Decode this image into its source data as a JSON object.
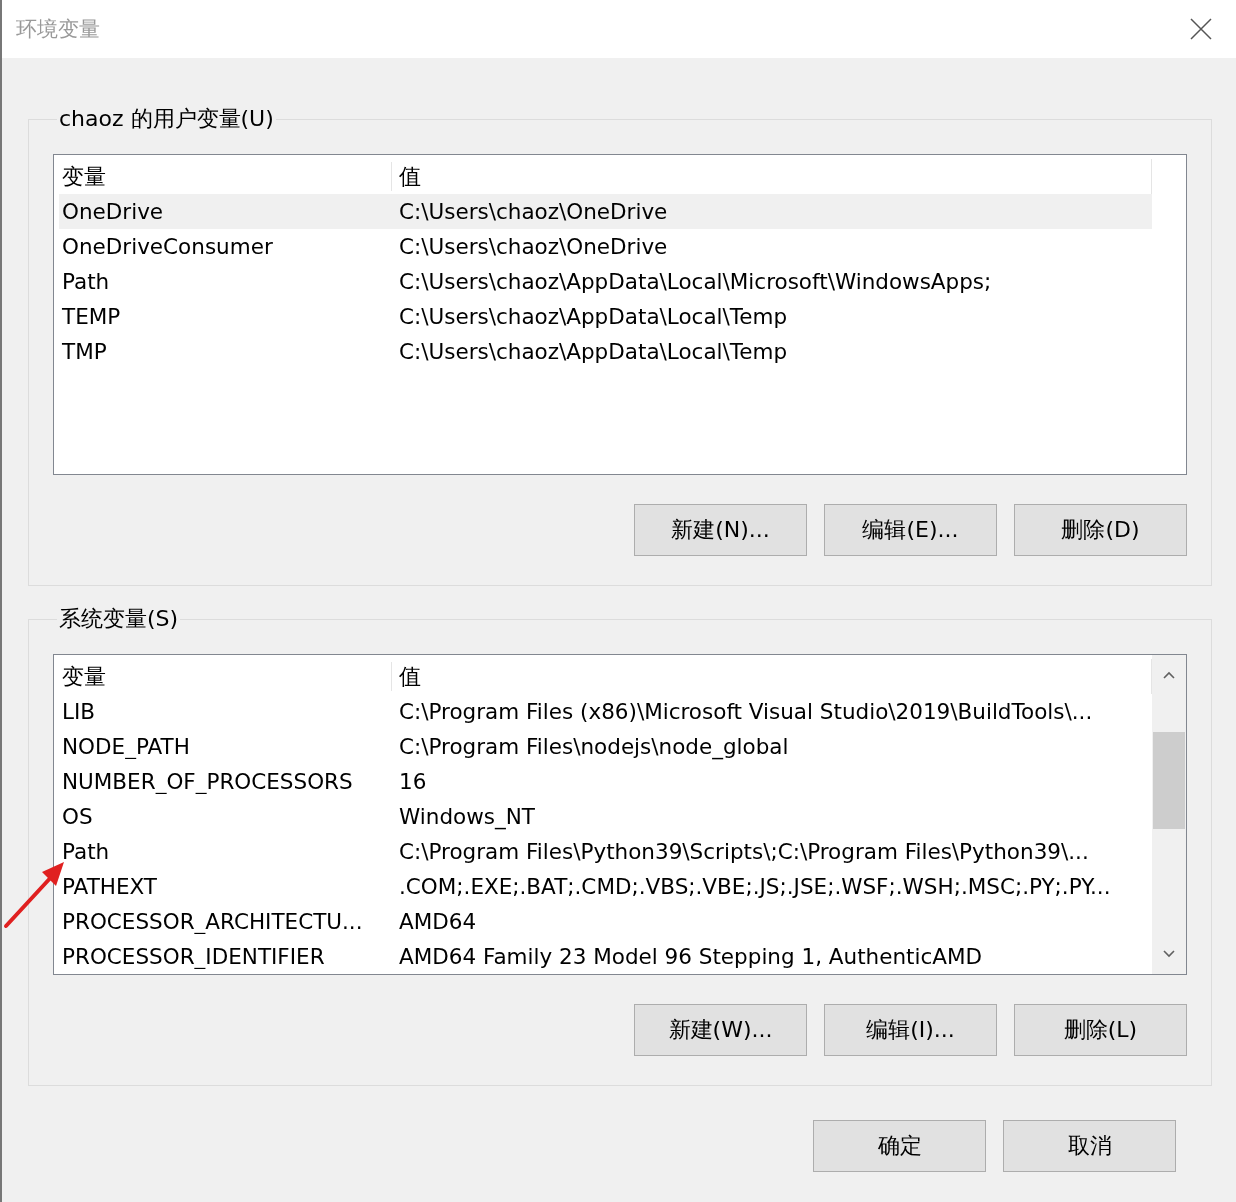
{
  "window": {
    "title": "环境变量"
  },
  "user_variables": {
    "title": "chaoz 的用户变量(U)",
    "columns": [
      "变量",
      "值"
    ],
    "rows": [
      {
        "name": "OneDrive",
        "value": "C:\\Users\\chaoz\\OneDrive",
        "selected": true
      },
      {
        "name": "OneDriveConsumer",
        "value": "C:\\Users\\chaoz\\OneDrive",
        "selected": false
      },
      {
        "name": "Path",
        "value": "C:\\Users\\chaoz\\AppData\\Local\\Microsoft\\WindowsApps;",
        "selected": false
      },
      {
        "name": "TEMP",
        "value": "C:\\Users\\chaoz\\AppData\\Local\\Temp",
        "selected": false
      },
      {
        "name": "TMP",
        "value": "C:\\Users\\chaoz\\AppData\\Local\\Temp",
        "selected": false
      }
    ],
    "buttons": [
      "新建(N)...",
      "编辑(E)...",
      "删除(D)"
    ]
  },
  "system_variables": {
    "title": "系统变量(S)",
    "columns": [
      "变量",
      "值"
    ],
    "rows": [
      {
        "name": "LIB",
        "value": "C:\\Program Files (x86)\\Microsoft Visual Studio\\2019\\BuildTools\\...",
        "selected": false
      },
      {
        "name": "NODE_PATH",
        "value": "C:\\Program Files\\nodejs\\node_global",
        "selected": false
      },
      {
        "name": "NUMBER_OF_PROCESSORS",
        "value": "16",
        "selected": false
      },
      {
        "name": "OS",
        "value": "Windows_NT",
        "selected": false
      },
      {
        "name": "Path",
        "value": "C:\\Program Files\\Python39\\Scripts\\;C:\\Program Files\\Python39\\...",
        "selected": false
      },
      {
        "name": "PATHEXT",
        "value": ".COM;.EXE;.BAT;.CMD;.VBS;.VBE;.JS;.JSE;.WSF;.WSH;.MSC;.PY;.PY...",
        "selected": false
      },
      {
        "name": "PROCESSOR_ARCHITECTU...",
        "value": "AMD64",
        "selected": false
      },
      {
        "name": "PROCESSOR_IDENTIFIER",
        "value": "AMD64 Family 23 Model 96 Stepping 1, AuthenticAMD",
        "selected": false
      }
    ],
    "buttons": [
      "新建(W)...",
      "编辑(I)...",
      "删除(L)"
    ]
  },
  "buttons": [
    "确定",
    "取消"
  ]
}
